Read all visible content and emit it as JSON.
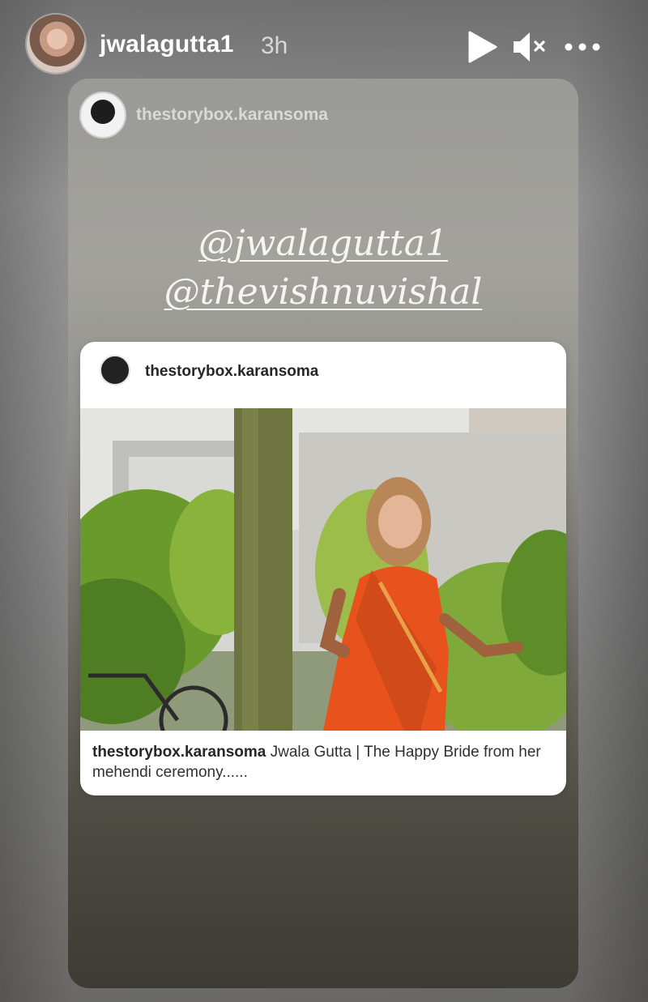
{
  "header": {
    "username": "jwalagutta1",
    "time": "3h",
    "icons": [
      "play-icon",
      "mute-icon",
      "more-icon"
    ]
  },
  "story": {
    "source_account": "thestorybox.karansoma",
    "mentions": [
      "@jwalagutta1",
      "@thevishnuvishal"
    ],
    "post": {
      "username": "thestorybox.karansoma",
      "caption_user": "thestorybox.karansoma",
      "caption_text": "Jwala Gutta | The Happy Bride from her mehendi ceremony......"
    }
  },
  "colors": {
    "saree": "#e8521c",
    "foliage": "#6f9a2e",
    "wall": "#d9d8d4"
  }
}
